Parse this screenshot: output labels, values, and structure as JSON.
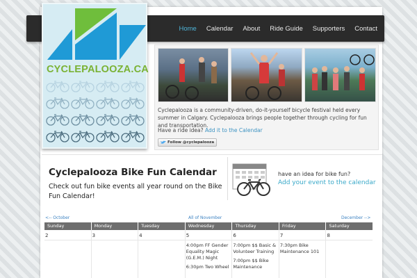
{
  "nav": {
    "items": [
      {
        "label": "Home",
        "active": true
      },
      {
        "label": "Calendar",
        "active": false
      },
      {
        "label": "About",
        "active": false
      },
      {
        "label": "Ride Guide",
        "active": false
      },
      {
        "label": "Supporters",
        "active": false
      },
      {
        "label": "Contact",
        "active": false
      }
    ]
  },
  "logo": {
    "text": "CYCLEPALOOZA.CA"
  },
  "intro": {
    "description": "Cyclepalooza is a community-driven, do-it-yourself bicycle festival held every summer in Calgary. Cyclepalooza brings people together through cycling for fun and transportation.",
    "ride_prompt": "Have a ride idea?",
    "ride_link": "Add it to the Calendar",
    "follow_button": "Follow @cyclepalooza"
  },
  "calendar_promo": {
    "title": "Cyclepalooza Bike Fun Calendar",
    "subtitle": "Check out fun bike events all year round on the Bike Fun Calendar!",
    "ad_question": "have an idea for bike fun?",
    "ad_link": "Add your event to the calendar"
  },
  "calendar": {
    "prev": "<-- October",
    "current": "All of November",
    "next": "December -->",
    "days": [
      "Sunday",
      "Monday",
      "Tuesday",
      "Wednesday",
      "Thursday",
      "Friday",
      "Saturday"
    ],
    "cells": [
      {
        "num": "2",
        "events": []
      },
      {
        "num": "3",
        "events": []
      },
      {
        "num": "4",
        "events": []
      },
      {
        "num": "5",
        "events": [
          "4:00pm FF Gender Equality Magic (G.E.M.) Night",
          "6:30pm Two Wheel"
        ]
      },
      {
        "num": "6",
        "events": [
          "7:00pm $$ Basic & Volunteer Training",
          "7:00pm $$ Bike Maintenance"
        ]
      },
      {
        "num": "7",
        "events": [
          "7:30pm Bike Maintenance 101"
        ]
      },
      {
        "num": "8",
        "events": []
      }
    ]
  },
  "colors": {
    "accent": "#4fb4d8",
    "logo_green": "#7ab234",
    "logo_blue": "#1f9ad6"
  }
}
